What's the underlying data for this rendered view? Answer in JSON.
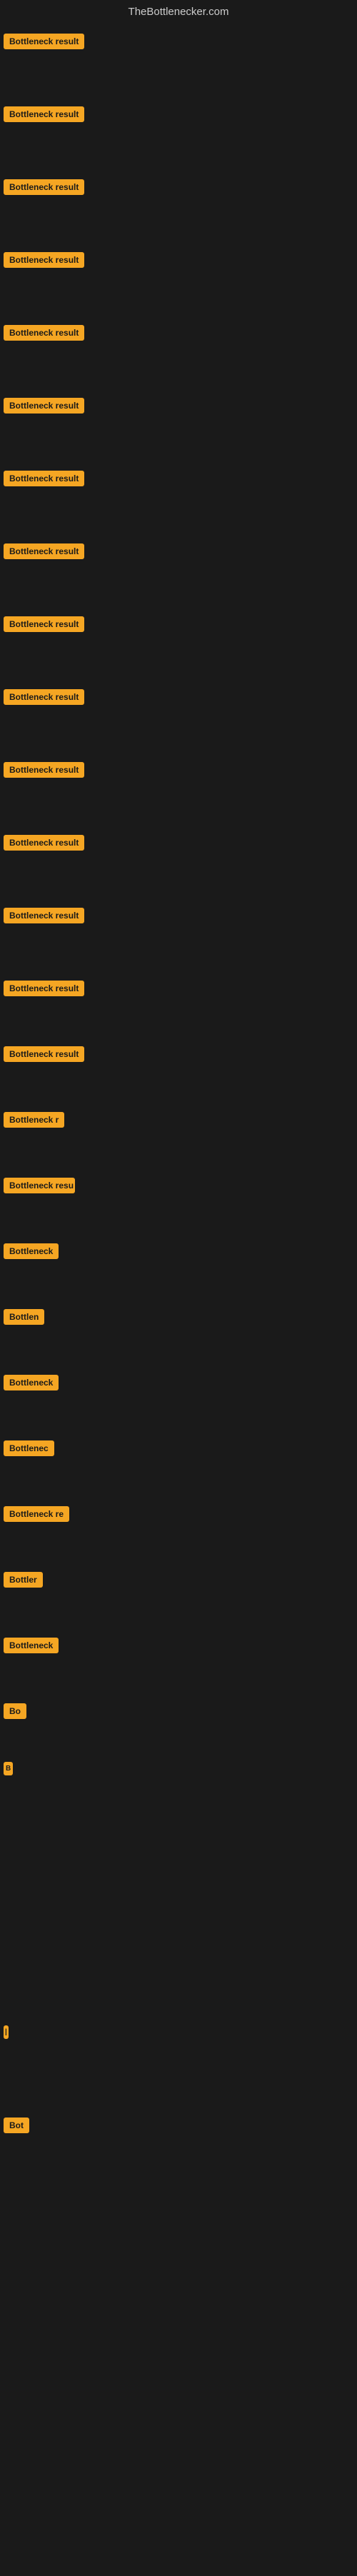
{
  "header": {
    "title": "TheBottlenecker.com"
  },
  "badge_label": "Bottleneck result",
  "rows": [
    {
      "id": 1,
      "label": "Bottleneck result"
    },
    {
      "id": 2,
      "label": "Bottleneck result"
    },
    {
      "id": 3,
      "label": "Bottleneck result"
    },
    {
      "id": 4,
      "label": "Bottleneck result"
    },
    {
      "id": 5,
      "label": "Bottleneck result"
    },
    {
      "id": 6,
      "label": "Bottleneck result"
    },
    {
      "id": 7,
      "label": "Bottleneck result"
    },
    {
      "id": 8,
      "label": "Bottleneck result"
    },
    {
      "id": 9,
      "label": "Bottleneck result"
    },
    {
      "id": 10,
      "label": "Bottleneck result"
    },
    {
      "id": 11,
      "label": "Bottleneck result"
    },
    {
      "id": 12,
      "label": "Bottleneck result"
    },
    {
      "id": 13,
      "label": "Bottleneck result"
    },
    {
      "id": 14,
      "label": "Bottleneck result"
    },
    {
      "id": 15,
      "label": "Bottleneck result"
    },
    {
      "id": 16,
      "label": "Bottleneck r"
    },
    {
      "id": 17,
      "label": "Bottleneck resu"
    },
    {
      "id": 18,
      "label": "Bottleneck"
    },
    {
      "id": 19,
      "label": "Bottlen"
    },
    {
      "id": 20,
      "label": "Bottleneck"
    },
    {
      "id": 21,
      "label": "Bottlenec"
    },
    {
      "id": 22,
      "label": "Bottleneck re"
    },
    {
      "id": 23,
      "label": "Bottler"
    },
    {
      "id": 24,
      "label": "Bottleneck"
    },
    {
      "id": 25,
      "label": "Bo"
    },
    {
      "id": 26,
      "label": "B"
    },
    {
      "id": 27,
      "label": ""
    },
    {
      "id": 28,
      "label": ""
    },
    {
      "id": 29,
      "label": "|"
    },
    {
      "id": 30,
      "label": "Bot"
    }
  ]
}
